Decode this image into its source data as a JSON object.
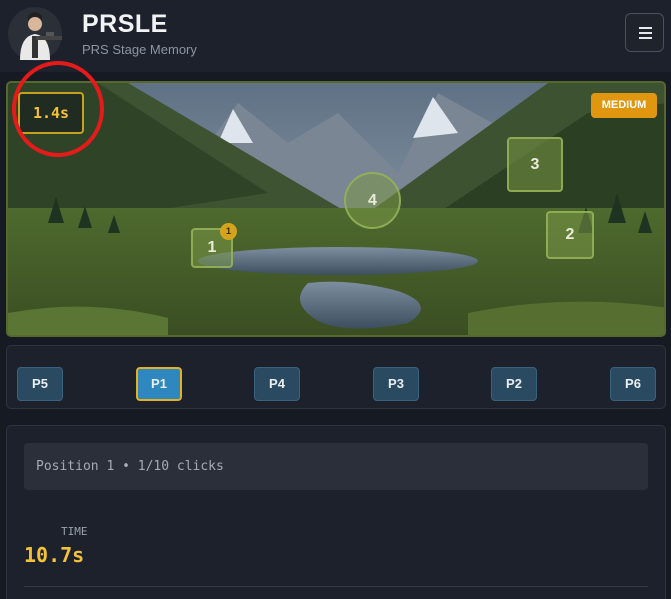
{
  "header": {
    "title": "PRSLE",
    "subtitle": "PRS Stage Memory",
    "avatar_icon": "shooter-avatar-icon",
    "menu_icon": "hamburger-menu-icon"
  },
  "stage": {
    "timer": "1.4s",
    "difficulty": "MEDIUM",
    "targets": [
      {
        "label": "1",
        "hits": "1"
      },
      {
        "label": "2"
      },
      {
        "label": "3"
      },
      {
        "label": "4"
      }
    ]
  },
  "positions": [
    "P5",
    "P1",
    "P4",
    "P3",
    "P2",
    "P6"
  ],
  "active_position": "P1",
  "info": {
    "status": "Position 1 • 1/10 clicks",
    "time_label": "TIME",
    "time_value": "10.7s"
  },
  "colors": {
    "accent_gold": "#f3c23a",
    "difficulty_orange": "#e0960f",
    "active_blue": "#2f87c0",
    "annotation_red": "#e51b1b"
  }
}
